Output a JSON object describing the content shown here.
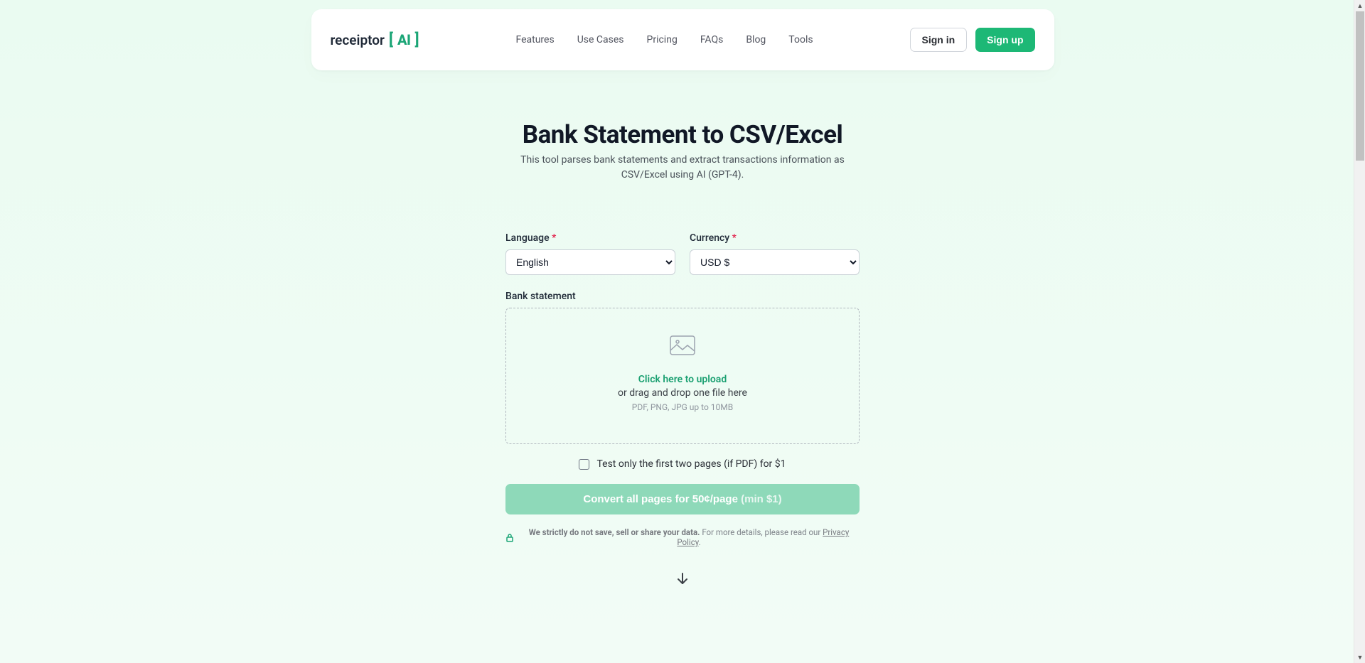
{
  "logo": {
    "text": "receiptor",
    "ai": "AI"
  },
  "nav": {
    "features": "Features",
    "usecases": "Use Cases",
    "pricing": "Pricing",
    "faqs": "FAQs",
    "blog": "Blog",
    "tools": "Tools"
  },
  "header": {
    "signin": "Sign in",
    "signup": "Sign up"
  },
  "main": {
    "title": "Bank Statement to CSV/Excel",
    "subtitle": "This tool parses bank statements and extract transactions information as CSV/Excel using AI (GPT-4)."
  },
  "form": {
    "language_label": "Language",
    "language_value": "English",
    "currency_label": "Currency",
    "currency_value": "USD $",
    "bank_statement_label": "Bank statement",
    "required_mark": "*"
  },
  "upload": {
    "title": "Click here to upload",
    "subtitle": "or drag and drop one file here",
    "hint": "PDF, PNG, JPG up to 10MB"
  },
  "checkbox": {
    "label": "Test only the first two pages (if PDF) for $1"
  },
  "convert": {
    "main": "Convert all pages for 50¢/page ",
    "min": "(min $1)"
  },
  "privacy": {
    "bold": "We strictly do not save, sell or share your data.",
    "text": " For more details, please read our ",
    "link": "Privacy Policy",
    "period": "."
  }
}
